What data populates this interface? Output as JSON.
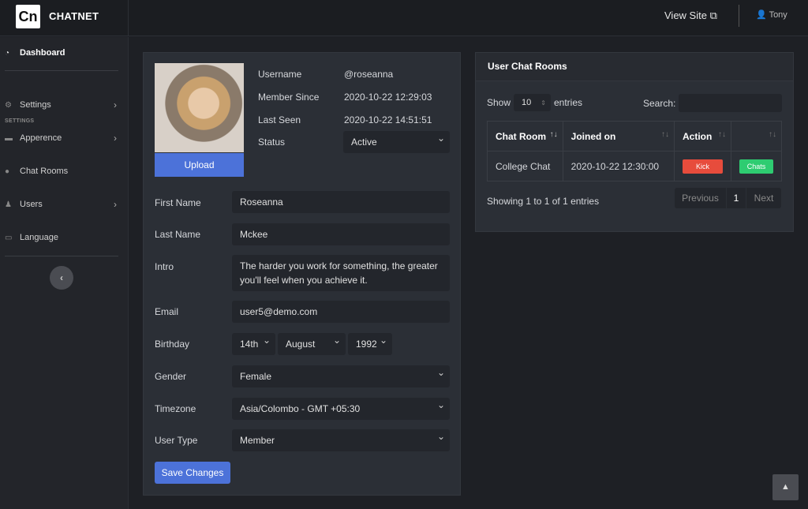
{
  "header": {
    "logo": "Cn",
    "brand": "CHATNET",
    "view_site": "View Site",
    "user": "Tony"
  },
  "sidebar": {
    "dashboard": "Dashboard",
    "section": "SETTINGS",
    "items": [
      {
        "label": "Settings"
      },
      {
        "label": "Apperence"
      },
      {
        "label": "Chat Rooms"
      },
      {
        "label": "Users"
      },
      {
        "label": "Language"
      }
    ]
  },
  "profile": {
    "upload": "Upload",
    "username_label": "Username",
    "username": "@roseanna",
    "member_since_label": "Member Since",
    "member_since": "2020-10-22 12:29:03",
    "last_seen_label": "Last Seen",
    "last_seen": "2020-10-22 14:51:51",
    "status_label": "Status",
    "status": "Active"
  },
  "form": {
    "first_name_label": "First Name",
    "first_name": "Roseanna",
    "last_name_label": "Last Name",
    "last_name": "Mckee",
    "intro_label": "Intro",
    "intro": "The harder you work for something, the greater you'll feel when you achieve it.",
    "email_label": "Email",
    "email": "user5@demo.com",
    "birthday_label": "Birthday",
    "day": "14th",
    "month": "August",
    "year": "1992",
    "gender_label": "Gender",
    "gender": "Female",
    "timezone_label": "Timezone",
    "timezone": "Asia/Colombo - GMT +05:30",
    "user_type_label": "User Type",
    "user_type": "Member",
    "save": "Save Changes"
  },
  "rooms": {
    "title": "User Chat Rooms",
    "show": "Show",
    "entries_count": "10",
    "entries": "entries",
    "search": "Search:",
    "columns": [
      "Chat Room",
      "Joined on",
      "Action",
      ""
    ],
    "rows": [
      {
        "room": "College Chat",
        "joined": "2020-10-22 12:30:00",
        "kick": "Kick",
        "chats": "Chats"
      }
    ],
    "info": "Showing 1 to 1 of 1 entries",
    "previous": "Previous",
    "page": "1",
    "next": "Next"
  },
  "colors": {
    "primary": "#4c72d9",
    "danger": "#e74c3c",
    "success": "#2ecc71"
  }
}
